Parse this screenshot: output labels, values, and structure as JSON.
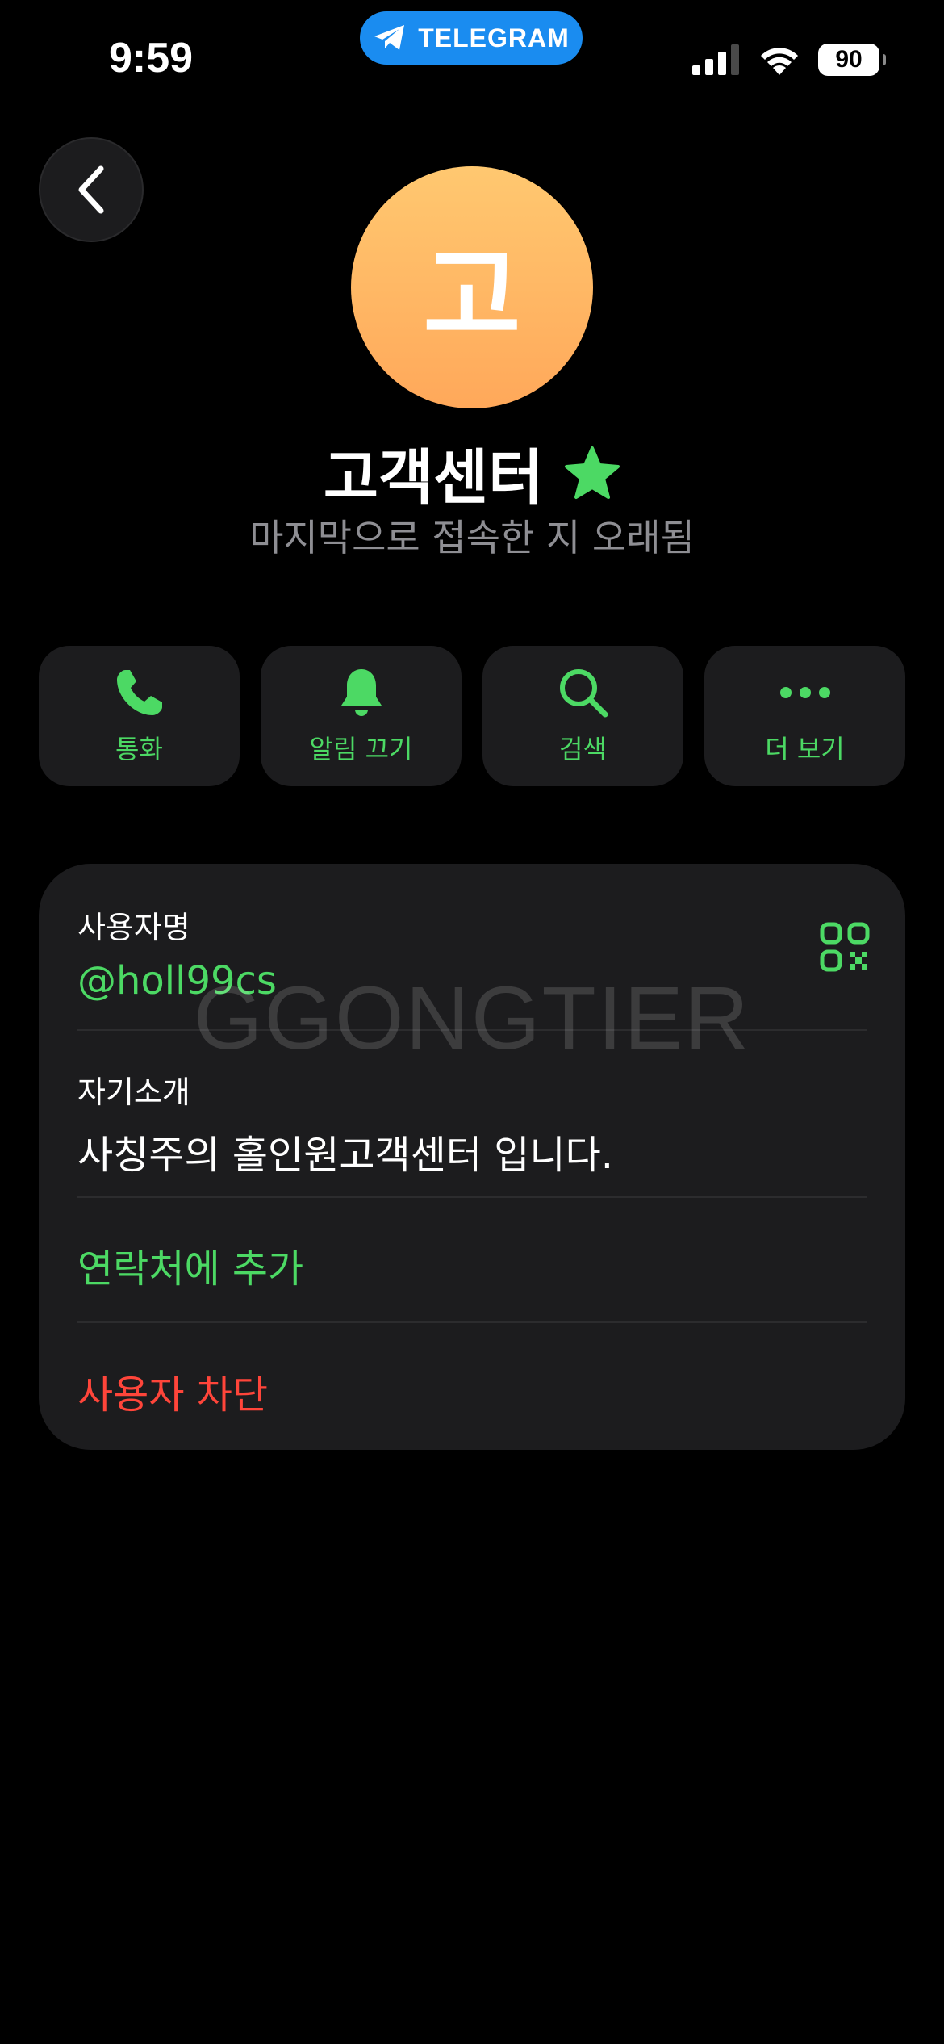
{
  "status_bar": {
    "time": "9:59",
    "app_pill": "TELEGRAM",
    "battery": "90"
  },
  "profile": {
    "avatar_initial": "고",
    "avatar_colors": [
      "#ffc870",
      "#ffa85a"
    ],
    "name": "고객센터",
    "status": "마지막으로 접속한 지 오래됨"
  },
  "actions": [
    {
      "label": "통화",
      "icon": "phone-icon"
    },
    {
      "label": "알림 끄기",
      "icon": "bell-icon"
    },
    {
      "label": "검색",
      "icon": "search-icon"
    },
    {
      "label": "더 보기",
      "icon": "more-icon"
    }
  ],
  "info": {
    "username_label": "사용자명",
    "username_value": "@holl99cs",
    "bio_label": "자기소개",
    "bio_value": "사칭주의 홀인원고객센터 입니다.",
    "add_contact": "연락처에 추가",
    "block_user": "사용자 차단"
  },
  "watermark": "GGONGTIER",
  "colors": {
    "accent_green": "#4cd964",
    "danger_red": "#ff453a",
    "card_bg": "#1c1c1e",
    "telegram_blue": "#1a8cf0"
  }
}
